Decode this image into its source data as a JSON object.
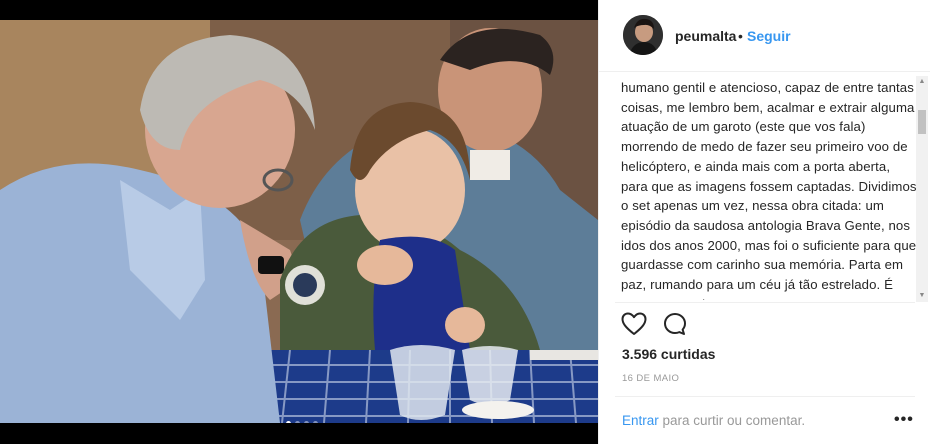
{
  "header": {
    "username": "peumalta",
    "separator": "•",
    "follow_label": "Seguir"
  },
  "caption": {
    "text": "humano gentil e atencioso, capaz de entre tantas coisas, me lembro bem, acalmar e extrair alguma atuação de um garoto (este que vos fala) morrendo de medo de fazer seu primeiro voo de helicóptero, e ainda mais com a porta aberta, para que as imagens fossem captadas. Dividimos o set apenas um vez, nessa obra citada: um episódio da saudosa antologia Brava Gente, nos idos dos anos 2000, mas foi o suficiente para que guardasse com carinho sua memória. Parta em paz, rumando para um céu já tão estrelado. É uma pena os bons"
  },
  "actions": {
    "like_icon": "heart-icon",
    "comment_icon": "comment-icon"
  },
  "likes_label": "3.596 curtidas",
  "date_label": "16 DE MAIO",
  "footer": {
    "login_link": "Entrar",
    "login_rest": " para curtir ou comentar.",
    "more_label": "•••"
  },
  "carousel": {
    "slide_count": 4,
    "active_index": 0
  },
  "colors": {
    "link": "#3897f0",
    "text": "#262626",
    "muted": "#999999"
  }
}
